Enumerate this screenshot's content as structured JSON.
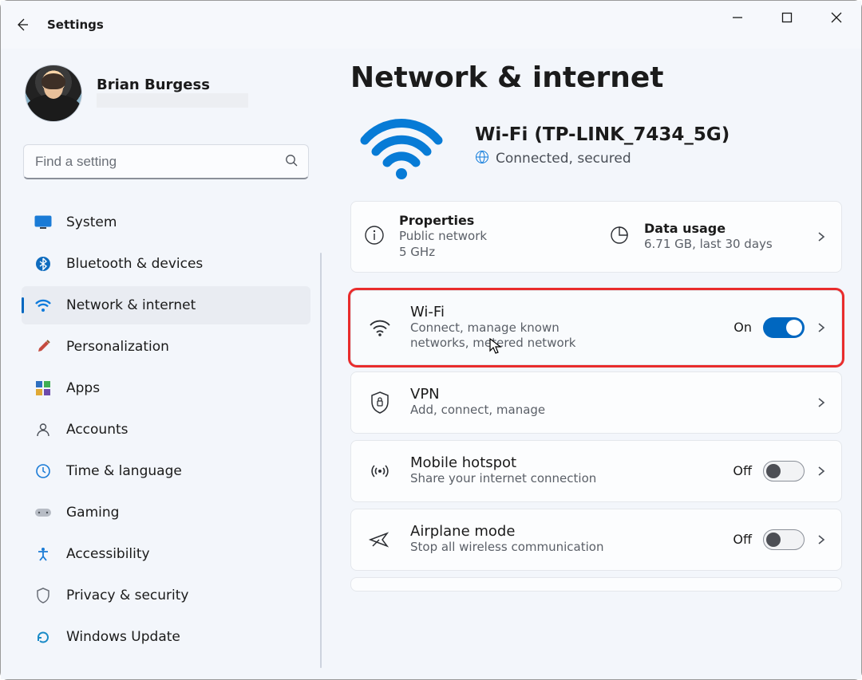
{
  "window": {
    "app_title": "Settings"
  },
  "profile": {
    "name": "Brian Burgess"
  },
  "search": {
    "placeholder": "Find a setting"
  },
  "sidebar": {
    "items": [
      {
        "id": "system",
        "label": "System"
      },
      {
        "id": "bluetooth",
        "label": "Bluetooth & devices"
      },
      {
        "id": "network",
        "label": "Network & internet",
        "active": true
      },
      {
        "id": "personalization",
        "label": "Personalization"
      },
      {
        "id": "apps",
        "label": "Apps"
      },
      {
        "id": "accounts",
        "label": "Accounts"
      },
      {
        "id": "time-language",
        "label": "Time & language"
      },
      {
        "id": "gaming",
        "label": "Gaming"
      },
      {
        "id": "accessibility",
        "label": "Accessibility"
      },
      {
        "id": "privacy",
        "label": "Privacy & security"
      },
      {
        "id": "updates",
        "label": "Windows Update"
      }
    ]
  },
  "page": {
    "title": "Network & internet"
  },
  "status": {
    "ssid_line": "Wi-Fi (TP-LINK_7434_5G)",
    "state_line": "Connected, secured"
  },
  "properties": {
    "title": "Properties",
    "line1": "Public network",
    "line2": "5 GHz"
  },
  "data_usage": {
    "title": "Data usage",
    "line1": "6.71 GB, last 30 days"
  },
  "cards": {
    "wifi": {
      "title": "Wi-Fi",
      "sub": "Connect, manage known networks, metered network",
      "toggle_label": "On",
      "toggle_state": "on"
    },
    "vpn": {
      "title": "VPN",
      "sub": "Add, connect, manage"
    },
    "hotspot": {
      "title": "Mobile hotspot",
      "sub": "Share your internet connection",
      "toggle_label": "Off",
      "toggle_state": "off"
    },
    "airplane": {
      "title": "Airplane mode",
      "sub": "Stop all wireless communication",
      "toggle_label": "Off",
      "toggle_state": "off"
    }
  }
}
